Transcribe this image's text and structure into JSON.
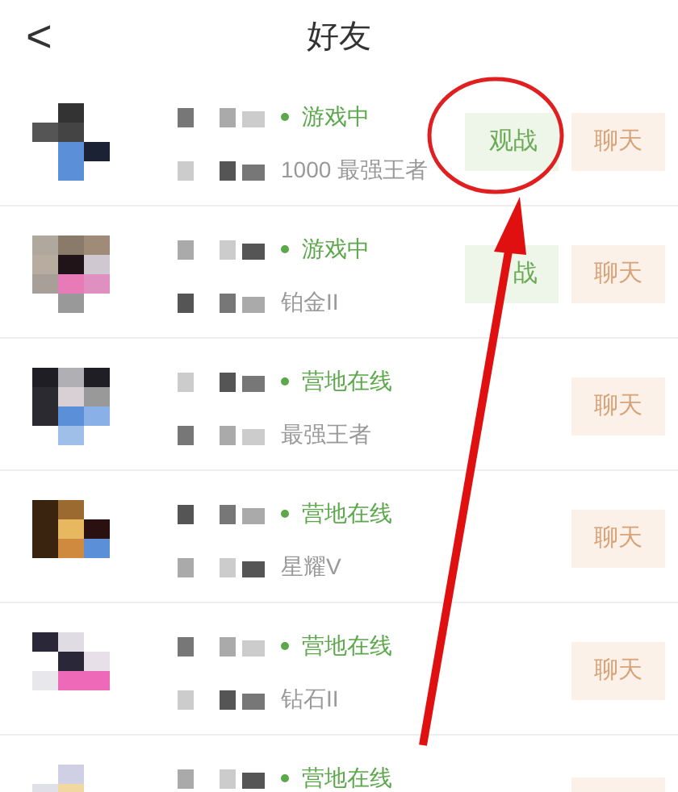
{
  "header": {
    "back": "<",
    "title": "好友"
  },
  "friends": [
    {
      "status": "游戏中",
      "color": "#5aa84a",
      "rank": "1000 最强王者",
      "watch": "观战",
      "chat": "聊天"
    },
    {
      "status": "游戏中",
      "color": "#5aa84a",
      "rank": "铂金II",
      "watch": "战",
      "chat": "聊天"
    },
    {
      "status": "营地在线",
      "color": "#5aa84a",
      "rank": "最强王者",
      "chat": "聊天"
    },
    {
      "status": "营地在线",
      "color": "#5aa84a",
      "rank": "星耀V",
      "chat": "聊天"
    },
    {
      "status": "营地在线",
      "color": "#5aa84a",
      "rank": "钻石II",
      "chat": "聊天"
    },
    {
      "status": "营地在线",
      "color": "#5aa84a"
    }
  ]
}
